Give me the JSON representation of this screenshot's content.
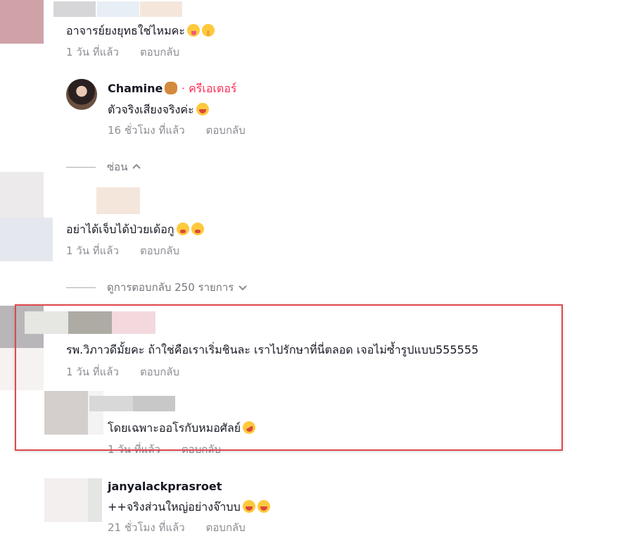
{
  "comments": [
    {
      "text": "อาจารย์ยงยุทธใช่ไหมคะ",
      "emojis": [
        "squinting-tongue-emoji",
        "shushing-face-emoji"
      ],
      "time": "1 วัน ที่แล้ว",
      "reply_label": "ตอบกลับ"
    },
    {
      "username": "Chamine",
      "username_emoji": "teddy-bear-emoji",
      "badge": "· ครีเอเตอร์",
      "text": "ตัวจริงเสียงจริงค่ะ",
      "emojis": [
        "laughing-face-emoji"
      ],
      "time": "16 ชั่วโมง ที่แล้ว",
      "reply_label": "ตอบกลับ"
    },
    {
      "text": "อย่าได้เจ็บได้ป่วยเด้อกู",
      "emojis": [
        "tired-face-emoji",
        "tired-face-emoji"
      ],
      "time": "1 วัน ที่แล้ว",
      "reply_label": "ตอบกลับ"
    },
    {
      "text": "รพ.วิภาวดีมั้ยคะ ถ้าใช่คือเราเริ่มชินละ เราไปรักษาที่นี่ตลอด เจอไม่ซ้ำรูปแบบ555555",
      "time": "1 วัน ที่แล้ว",
      "reply_label": "ตอบกลับ"
    },
    {
      "text": "โดยเฉพาะออโรกับหมอศัลย์",
      "emojis": [
        "rolling-on-floor-laughing-emoji"
      ],
      "time": "1 วัน ที่แล้ว",
      "reply_label": "ตอบกลับ"
    },
    {
      "username": "janyalackprasroet",
      "text": "++จริงส่วนใหญ่อย่างจ๊าบบ",
      "emojis": [
        "laughing-face-emoji",
        "laughing-face-emoji"
      ],
      "time": "21 ชั่วโมง ที่แล้ว",
      "reply_label": "ตอบกลับ"
    }
  ],
  "toggles": {
    "hide_label": "ซ่อน",
    "view_replies_label": "ดูการตอบกลับ 250 รายการ"
  },
  "colors": {
    "creator_badge": "#fe2c55",
    "highlight_border": "#e0474c",
    "secondary_text": "#8a8b91"
  }
}
